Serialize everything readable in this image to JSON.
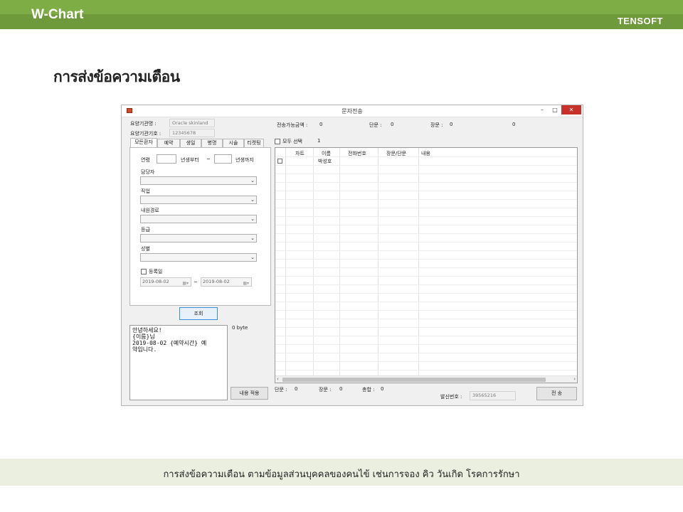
{
  "slide": {
    "app_title": "W-Chart",
    "brand": "TENSOFT",
    "heading": "การส่งข้อความเตือน",
    "footer": "การส่งข้อความเตือน ตามข้อมูลส่วนบุคคลของคนไข้ เช่นการจอง คิว วันเกิด โรคการรักษา"
  },
  "window": {
    "title": "문자전송",
    "min_glyph": "–",
    "max_glyph": "□",
    "close_glyph": "✕",
    "icon": "app-icon"
  },
  "clinic": {
    "name_label": "요양기관명 :",
    "name_value": "Oracle skinland",
    "code_label": "요양기관기호 :",
    "code_value": "12345678"
  },
  "summary": {
    "amount_label": "전송가능금액 :",
    "amount_value": "0",
    "short_label": "단문 :",
    "short_value": "0",
    "long_label": "장문 :",
    "long_value": "0",
    "extra_value": "0"
  },
  "tabs": [
    "모든환자",
    "예약",
    "생일",
    "병명",
    "시술",
    "티켓팅"
  ],
  "filters": {
    "age_label": "연령",
    "from_label": "년생부터",
    "tilde": "~",
    "to_label": "년생까지",
    "staff_label": "담당자",
    "job_label": "직업",
    "route_label": "내원경로",
    "grade_label": "등급",
    "gender_label": "성별",
    "regdate_label": "등록일",
    "date_from": "2019-08-02",
    "date_to": "2019-08-02"
  },
  "search_button": "조회",
  "message": {
    "lines": [
      "안녕하세요!",
      "{이름}님",
      "2019-08-02 {예약시간} 예",
      "약입니다."
    ],
    "bytes": "0 byte",
    "apply_button": "내용 적용"
  },
  "select_all": {
    "label": "모두 선택",
    "count": "1"
  },
  "grid": {
    "columns": [
      "차트",
      "이름",
      "전화번호",
      "장문/단문",
      "내용"
    ],
    "rows": [
      {
        "chart": "",
        "name": "박성호",
        "phone": "",
        "type": "",
        "content": ""
      }
    ]
  },
  "bottom": {
    "short_label": "단문 :",
    "short_value": "0",
    "long_label": "장문 :",
    "long_value": "0",
    "total_label": "총합 :",
    "total_value": "0",
    "sender_label": "발신번호 :",
    "sender_value": "39565216",
    "send_button": "전   송"
  }
}
